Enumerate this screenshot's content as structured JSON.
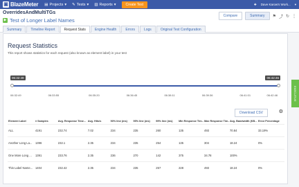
{
  "topnav": {
    "logo": "BlazeMeter",
    "projects": "Projects",
    "tests": "Tests",
    "reports": "Reports",
    "create": "Create Test",
    "user": "Dave Karow's Work..."
  },
  "header": {
    "test_name": "OverridesAndMultiTGs",
    "report_title": "Test of Longer Label Names",
    "compare": "Compare",
    "summary": "Summary"
  },
  "tabs": [
    "Summary",
    "Timeline Report",
    "Request Stats",
    "Engine Health",
    "Errors",
    "Logs",
    "Original Test Configuration"
  ],
  "report": {
    "title": "Request Statistics",
    "description": "This report shows statistics for each request (also known as element label) in your test"
  },
  "timeline": {
    "start": "06:32:49",
    "end": "06:42:46",
    "ticks": [
      "06:32:49",
      "06:33:55",
      "06:35:20",
      "06:36:45",
      "06:38:11",
      "06:39:36",
      "06:41:01",
      "06:42:46"
    ]
  },
  "download": "Download CSV",
  "side_tab": "EXECUTIVE",
  "table": {
    "headers": [
      "Element Label",
      "# Samples",
      "Avg. Response Time...",
      "Avg. Hits/s",
      "90% line (ms)",
      "95% line (ms)",
      "99% line (ms)",
      "Min Response Tim...",
      "Max Response Tim...",
      "Avg. Bandwidth (KB...",
      "Error Percentage"
    ],
    "rows": [
      [
        "ALL",
        "4191",
        "232.74",
        "7.02",
        "234",
        "235",
        "260",
        "135",
        "493",
        "70.84",
        "33.19%"
      ],
      [
        "Another Long La...",
        "1396",
        "232.1",
        "2.35",
        "234",
        "235",
        "254",
        "135",
        "304",
        "18.24",
        "0%"
      ],
      [
        "One More Long ...",
        "1391",
        "233.76",
        "2.35",
        "236",
        "270",
        "142",
        "375",
        "34.78",
        "100%"
      ],
      [
        "This Label Name...",
        "1404",
        "232.42",
        "2.35",
        "234",
        "235",
        "257",
        "228",
        "493",
        "18.24",
        "0%"
      ]
    ]
  }
}
